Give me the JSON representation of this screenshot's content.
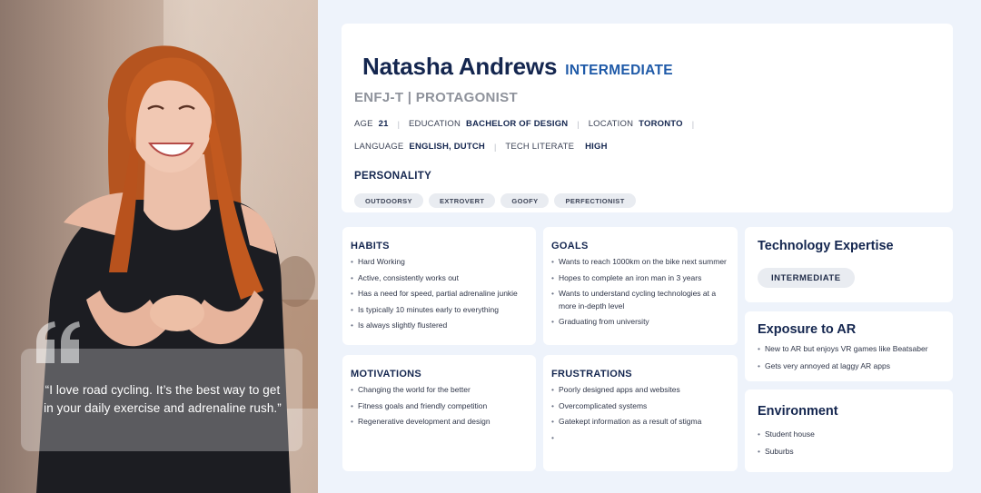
{
  "quote": {
    "text": "“I love road cycling. It’s the best way to get in your daily exercise and adrenaline rush.”"
  },
  "profile": {
    "name": "Natasha Andrews",
    "level": "INTERMEDIATE",
    "type": "ENFJ-T | PROTAGONIST",
    "meta_row_1": [
      {
        "label": "AGE",
        "value": "21"
      },
      {
        "label": "EDUCATION",
        "value": "BACHELOR OF DESIGN"
      },
      {
        "label": "LOCATION",
        "value": "TORONTO"
      }
    ],
    "meta_row_2": [
      {
        "label": "LANGUAGE",
        "value": "ENGLISH, DUTCH"
      },
      {
        "label": "TECH LITERATE",
        "value": "HIGH"
      }
    ],
    "personality_title": "PERSONALITY",
    "personality_tags": [
      "OUTDOORSY",
      "EXTROVERT",
      "GOOFY",
      "PERFECTIONIST"
    ]
  },
  "habits": {
    "title": "HABITS",
    "items": [
      "Hard Working",
      "Active, consistently works out",
      "Has a need for speed, partial adrenaline junkie",
      "Is typically 10 minutes early to everything",
      "Is always slightly flustered"
    ]
  },
  "goals": {
    "title": "GOALS",
    "items": [
      "Wants to reach 1000km on the bike next summer",
      "Hopes to complete an iron man in 3 years",
      "Wants to understand cycling technologies at a more in-depth level",
      "Graduating from university"
    ]
  },
  "motivations": {
    "title": "MOTIVATIONS",
    "items": [
      "Changing the world for the better",
      "Fitness goals and friendly competition",
      "Regenerative development and design"
    ]
  },
  "frustrations": {
    "title": "FRUSTRATIONS",
    "items": [
      "Poorly designed apps and websites",
      "Overcomplicated systems",
      "Gatekept information as a result of stigma",
      ""
    ]
  },
  "tech_expertise": {
    "title": "Technology Expertise",
    "level": "INTERMEDIATE"
  },
  "exposure_ar": {
    "title": "Exposure to AR",
    "items": [
      "New to AR but enjoys VR games like Beatsaber",
      "Gets very annoyed at laggy AR apps"
    ]
  },
  "environment": {
    "title": "Environment",
    "items": [
      "Student house",
      "Suburbs"
    ]
  },
  "colors": {
    "accent_blue": "#1f5aa8",
    "navy": "#14264f",
    "page_bg": "#eef3fb"
  }
}
